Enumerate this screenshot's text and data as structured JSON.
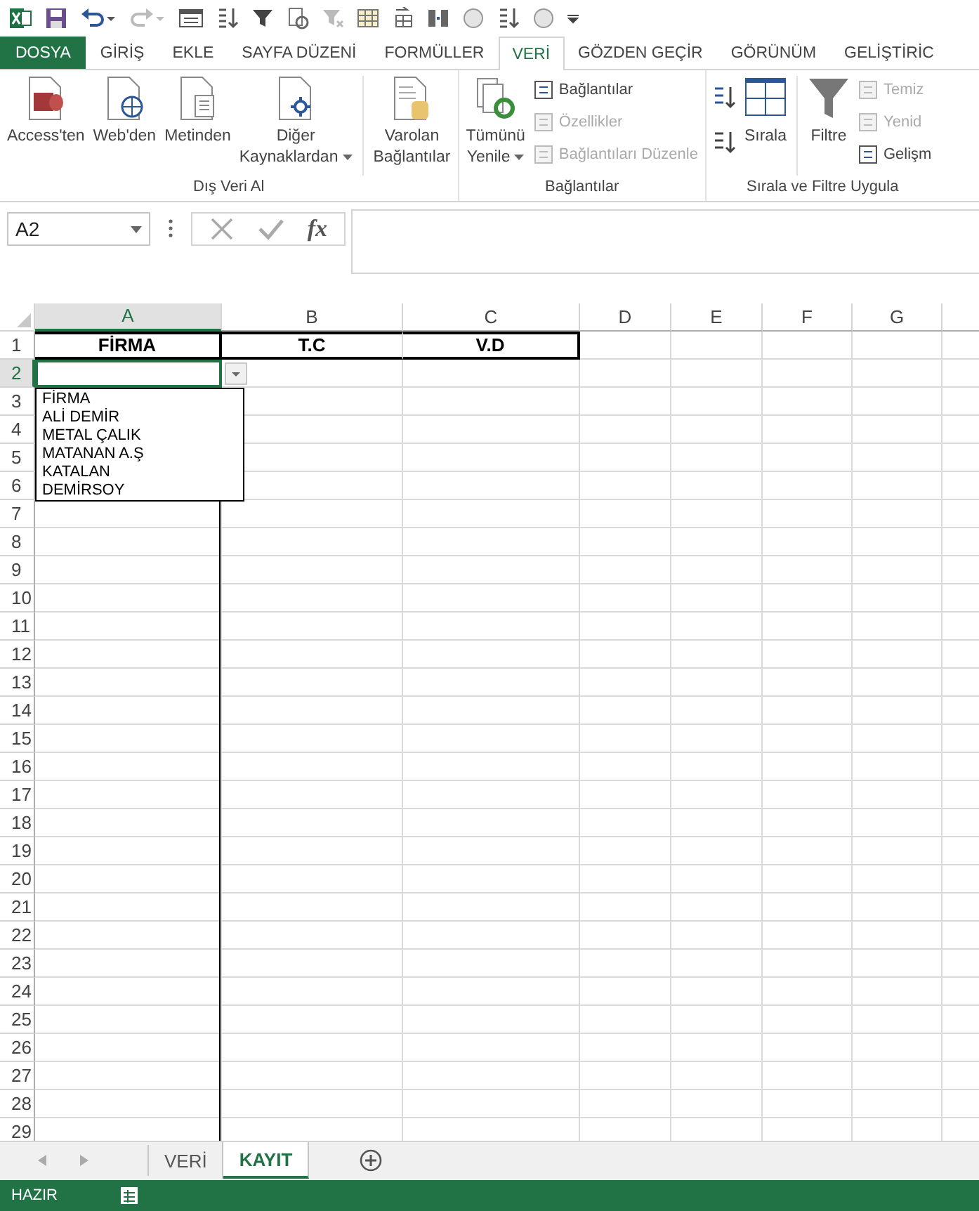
{
  "ribbon_tabs": [
    {
      "label": "DOSYA",
      "kind": "file",
      "selected": false
    },
    {
      "label": "GİRİŞ",
      "kind": "tab",
      "selected": false
    },
    {
      "label": "EKLE",
      "kind": "tab",
      "selected": false
    },
    {
      "label": "SAYFA DÜZENİ",
      "kind": "tab",
      "selected": false
    },
    {
      "label": "FORMÜLLER",
      "kind": "tab",
      "selected": false
    },
    {
      "label": "VERİ",
      "kind": "tab",
      "selected": true
    },
    {
      "label": "GÖZDEN GEÇİR",
      "kind": "tab",
      "selected": false
    },
    {
      "label": "GÖRÜNÜM",
      "kind": "tab",
      "selected": false
    },
    {
      "label": "GELİŞTİRİC",
      "kind": "tab",
      "selected": false
    }
  ],
  "ribbon_groups": [
    {
      "label": "Dış Veri Al",
      "items": [
        {
          "kind": "large",
          "lines": [
            "Access'ten"
          ],
          "dropdown": false
        },
        {
          "kind": "large",
          "lines": [
            "Web'den"
          ],
          "dropdown": false
        },
        {
          "kind": "large",
          "lines": [
            "Metinden"
          ],
          "dropdown": false
        },
        {
          "kind": "large",
          "lines": [
            "Diğer",
            "Kaynaklardan"
          ],
          "dropdown": true
        },
        {
          "kind": "separator"
        },
        {
          "kind": "large",
          "lines": [
            "Varolan",
            "Bağlantılar"
          ],
          "dropdown": false
        }
      ]
    },
    {
      "label": "Bağlantılar",
      "items": [
        {
          "kind": "large",
          "lines": [
            "Tümünü",
            "Yenile"
          ],
          "dropdown": true
        },
        {
          "kind": "stack",
          "buttons": [
            {
              "label": "Bağlantılar",
              "disabled": false
            },
            {
              "label": "Özellikler",
              "disabled": true
            },
            {
              "label": "Bağlantıları Düzenle",
              "disabled": true
            }
          ]
        }
      ]
    },
    {
      "label": "Sırala ve Filtre Uygula",
      "items": [
        {
          "kind": "sortstack"
        },
        {
          "kind": "large",
          "lines": [
            "Sırala"
          ],
          "dropdown": false
        },
        {
          "kind": "separator"
        },
        {
          "kind": "large",
          "lines": [
            "Filtre"
          ],
          "dropdown": false
        },
        {
          "kind": "stack",
          "buttons": [
            {
              "label": "Temiz",
              "disabled": true
            },
            {
              "label": "Yenid",
              "disabled": true
            },
            {
              "label": "Gelişm",
              "disabled": false
            }
          ]
        }
      ]
    }
  ],
  "formula_bar": {
    "name_box": "A2",
    "function_label": "fx"
  },
  "columns": [
    {
      "label": "A",
      "selected": true
    },
    {
      "label": "B",
      "selected": false
    },
    {
      "label": "C",
      "selected": false
    },
    {
      "label": "D",
      "selected": false
    },
    {
      "label": "E",
      "selected": false
    },
    {
      "label": "F",
      "selected": false
    },
    {
      "label": "G",
      "selected": false
    }
  ],
  "rows": [
    {
      "label": "1",
      "selected": false
    },
    {
      "label": "2",
      "selected": true
    },
    {
      "label": "3",
      "selected": false
    },
    {
      "label": "4",
      "selected": false
    },
    {
      "label": "5",
      "selected": false
    },
    {
      "label": "6",
      "selected": false
    },
    {
      "label": "7",
      "selected": false
    },
    {
      "label": "8",
      "selected": false
    },
    {
      "label": "9",
      "selected": false
    },
    {
      "label": "10",
      "selected": false
    },
    {
      "label": "11",
      "selected": false
    },
    {
      "label": "12",
      "selected": false
    },
    {
      "label": "13",
      "selected": false
    },
    {
      "label": "14",
      "selected": false
    },
    {
      "label": "15",
      "selected": false
    },
    {
      "label": "16",
      "selected": false
    },
    {
      "label": "17",
      "selected": false
    },
    {
      "label": "18",
      "selected": false
    },
    {
      "label": "19",
      "selected": false
    },
    {
      "label": "20",
      "selected": false
    },
    {
      "label": "21",
      "selected": false
    },
    {
      "label": "22",
      "selected": false
    },
    {
      "label": "23",
      "selected": false
    },
    {
      "label": "24",
      "selected": false
    },
    {
      "label": "25",
      "selected": false
    },
    {
      "label": "26",
      "selected": false
    },
    {
      "label": "27",
      "selected": false
    },
    {
      "label": "28",
      "selected": false
    },
    {
      "label": "29",
      "selected": false
    }
  ],
  "header_cells": [
    "FİRMA",
    "T.C",
    "V.D"
  ],
  "dropdown_list": [
    "FİRMA",
    "ALİ DEMİR",
    "METAL ÇALIK",
    "MATANAN A.Ş",
    "KATALAN",
    "DEMİRSOY"
  ],
  "sheet_tabs": [
    {
      "label": "VERİ",
      "selected": false
    },
    {
      "label": "KAYIT",
      "selected": true
    }
  ],
  "status_bar": {
    "status": "HAZIR"
  }
}
